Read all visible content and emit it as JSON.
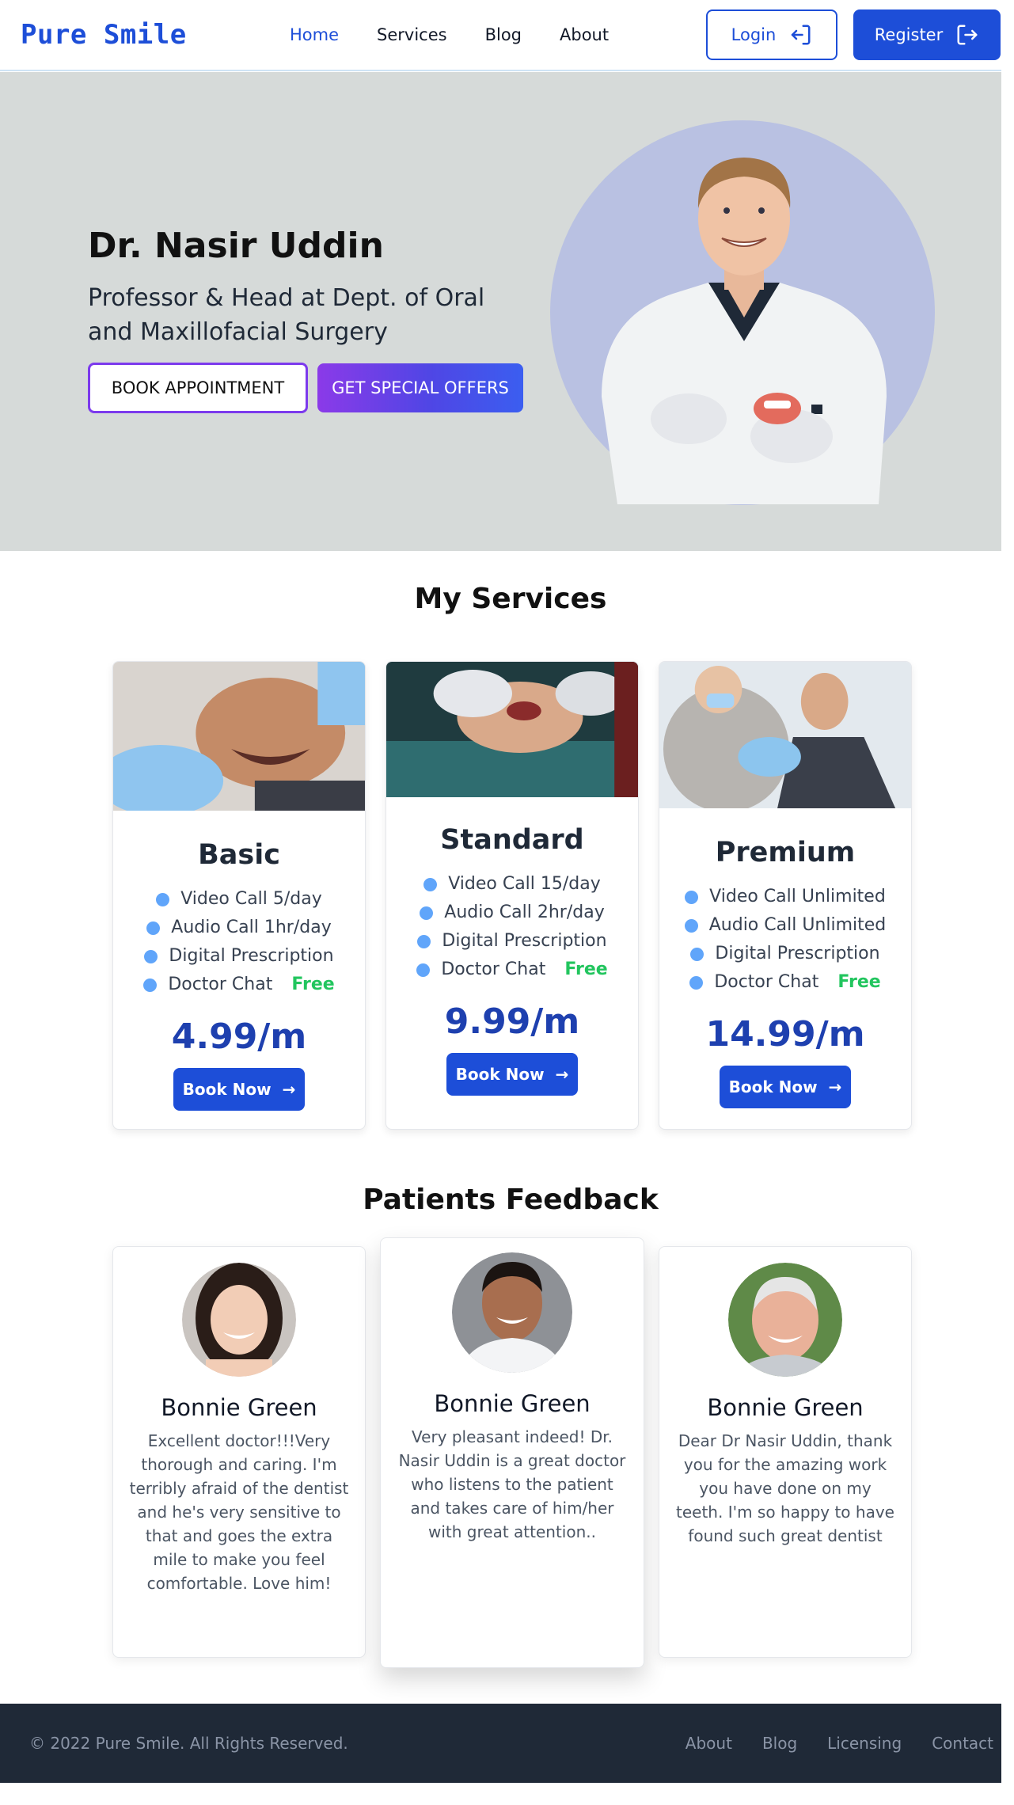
{
  "nav": {
    "logo": "Pure Smile",
    "links": [
      "Home",
      "Services",
      "Blog",
      "About"
    ],
    "login": "Login",
    "register": "Register"
  },
  "hero": {
    "name": "Dr. Nasir Uddin",
    "title": "Professor & Head at Dept. of Oral and Maxillofacial Surgery",
    "book_button": "BOOK APPOINTMENT",
    "offers_button": "GET SPECIAL OFFERS"
  },
  "services": {
    "heading": "My Services",
    "plans": [
      {
        "name": "Basic",
        "features": [
          "Video Call 5/day",
          "Audio Call 1hr/day",
          "Digital Prescription",
          "Doctor Chat"
        ],
        "free_label": "Free",
        "price": "4.99/m",
        "button": "Book Now"
      },
      {
        "name": "Standard",
        "features": [
          "Video Call 15/day",
          "Audio Call 2hr/day",
          "Digital Prescription",
          "Doctor Chat"
        ],
        "free_label": "Free",
        "price": "9.99/m",
        "button": "Book Now"
      },
      {
        "name": "Premium",
        "features": [
          "Video Call Unlimited",
          "Audio Call Unlimited",
          "Digital Prescription",
          "Doctor Chat"
        ],
        "free_label": "Free",
        "price": "14.99/m",
        "button": "Book Now"
      }
    ]
  },
  "feedback": {
    "heading": "Patients Feedback",
    "items": [
      {
        "name": "Bonnie Green",
        "text": "Excellent doctor!!!Very thorough and caring. I'm terribly afraid of the dentist and he's very sensitive to that and goes the extra mile to make you feel comfortable. Love him!"
      },
      {
        "name": "Bonnie Green",
        "text": "Very pleasant indeed! Dr. Nasir Uddin is a great doctor who listens to the patient and takes care of him/her with great attention.."
      },
      {
        "name": "Bonnie Green",
        "text": "Dear Dr Nasir Uddin, thank you for the amazing work you have done on my teeth. I'm so happy to have found such great dentist"
      }
    ]
  },
  "footer": {
    "copyright": "© 2022 Pure Smile. All Rights Reserved.",
    "links": [
      "About",
      "Blog",
      "Licensing",
      "Contact"
    ]
  },
  "colors": {
    "brand": "#1d4ed8",
    "hero_bg": "#d6dad9",
    "price": "#1e40af",
    "free": "#22c55e",
    "footer_bg": "#1f2937"
  }
}
